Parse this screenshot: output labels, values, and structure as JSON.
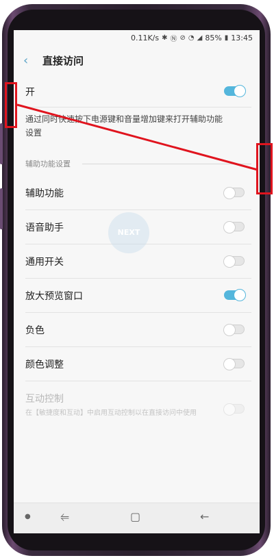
{
  "status_bar": {
    "speed": "0.11K/s",
    "icons": [
      "bluetooth-icon",
      "nfc-icon",
      "mute-icon",
      "wifi-icon",
      "signal-icon"
    ],
    "battery": "85%",
    "time": "13:45"
  },
  "header": {
    "back_icon": "chevron-left-icon",
    "title": "直接访问"
  },
  "master_toggle": {
    "label": "开",
    "on": true
  },
  "description": "通过同时快速按下电源键和音量增加键来打开辅助功能设置",
  "section": {
    "title": "辅助功能设置"
  },
  "items": [
    {
      "label": "辅助功能",
      "on": false
    },
    {
      "label": "语音助手",
      "on": false
    },
    {
      "label": "通用开关",
      "on": false
    },
    {
      "label": "放大预览窗口",
      "on": true
    },
    {
      "label": "负色",
      "on": false
    },
    {
      "label": "颜色调整",
      "on": false
    }
  ],
  "interaction_control": {
    "label": "互动控制",
    "sub": "在【敏捷度和互动】中启用互动控制以在直接访问中使用",
    "on": false,
    "enabled": false
  },
  "watermark": "NEXT",
  "navbar": {
    "icons": [
      "dot-icon",
      "recents-icon",
      "home-icon",
      "back-arrow-icon"
    ]
  },
  "colors": {
    "accent": "#54b6dc",
    "highlight": "#e0141e"
  }
}
